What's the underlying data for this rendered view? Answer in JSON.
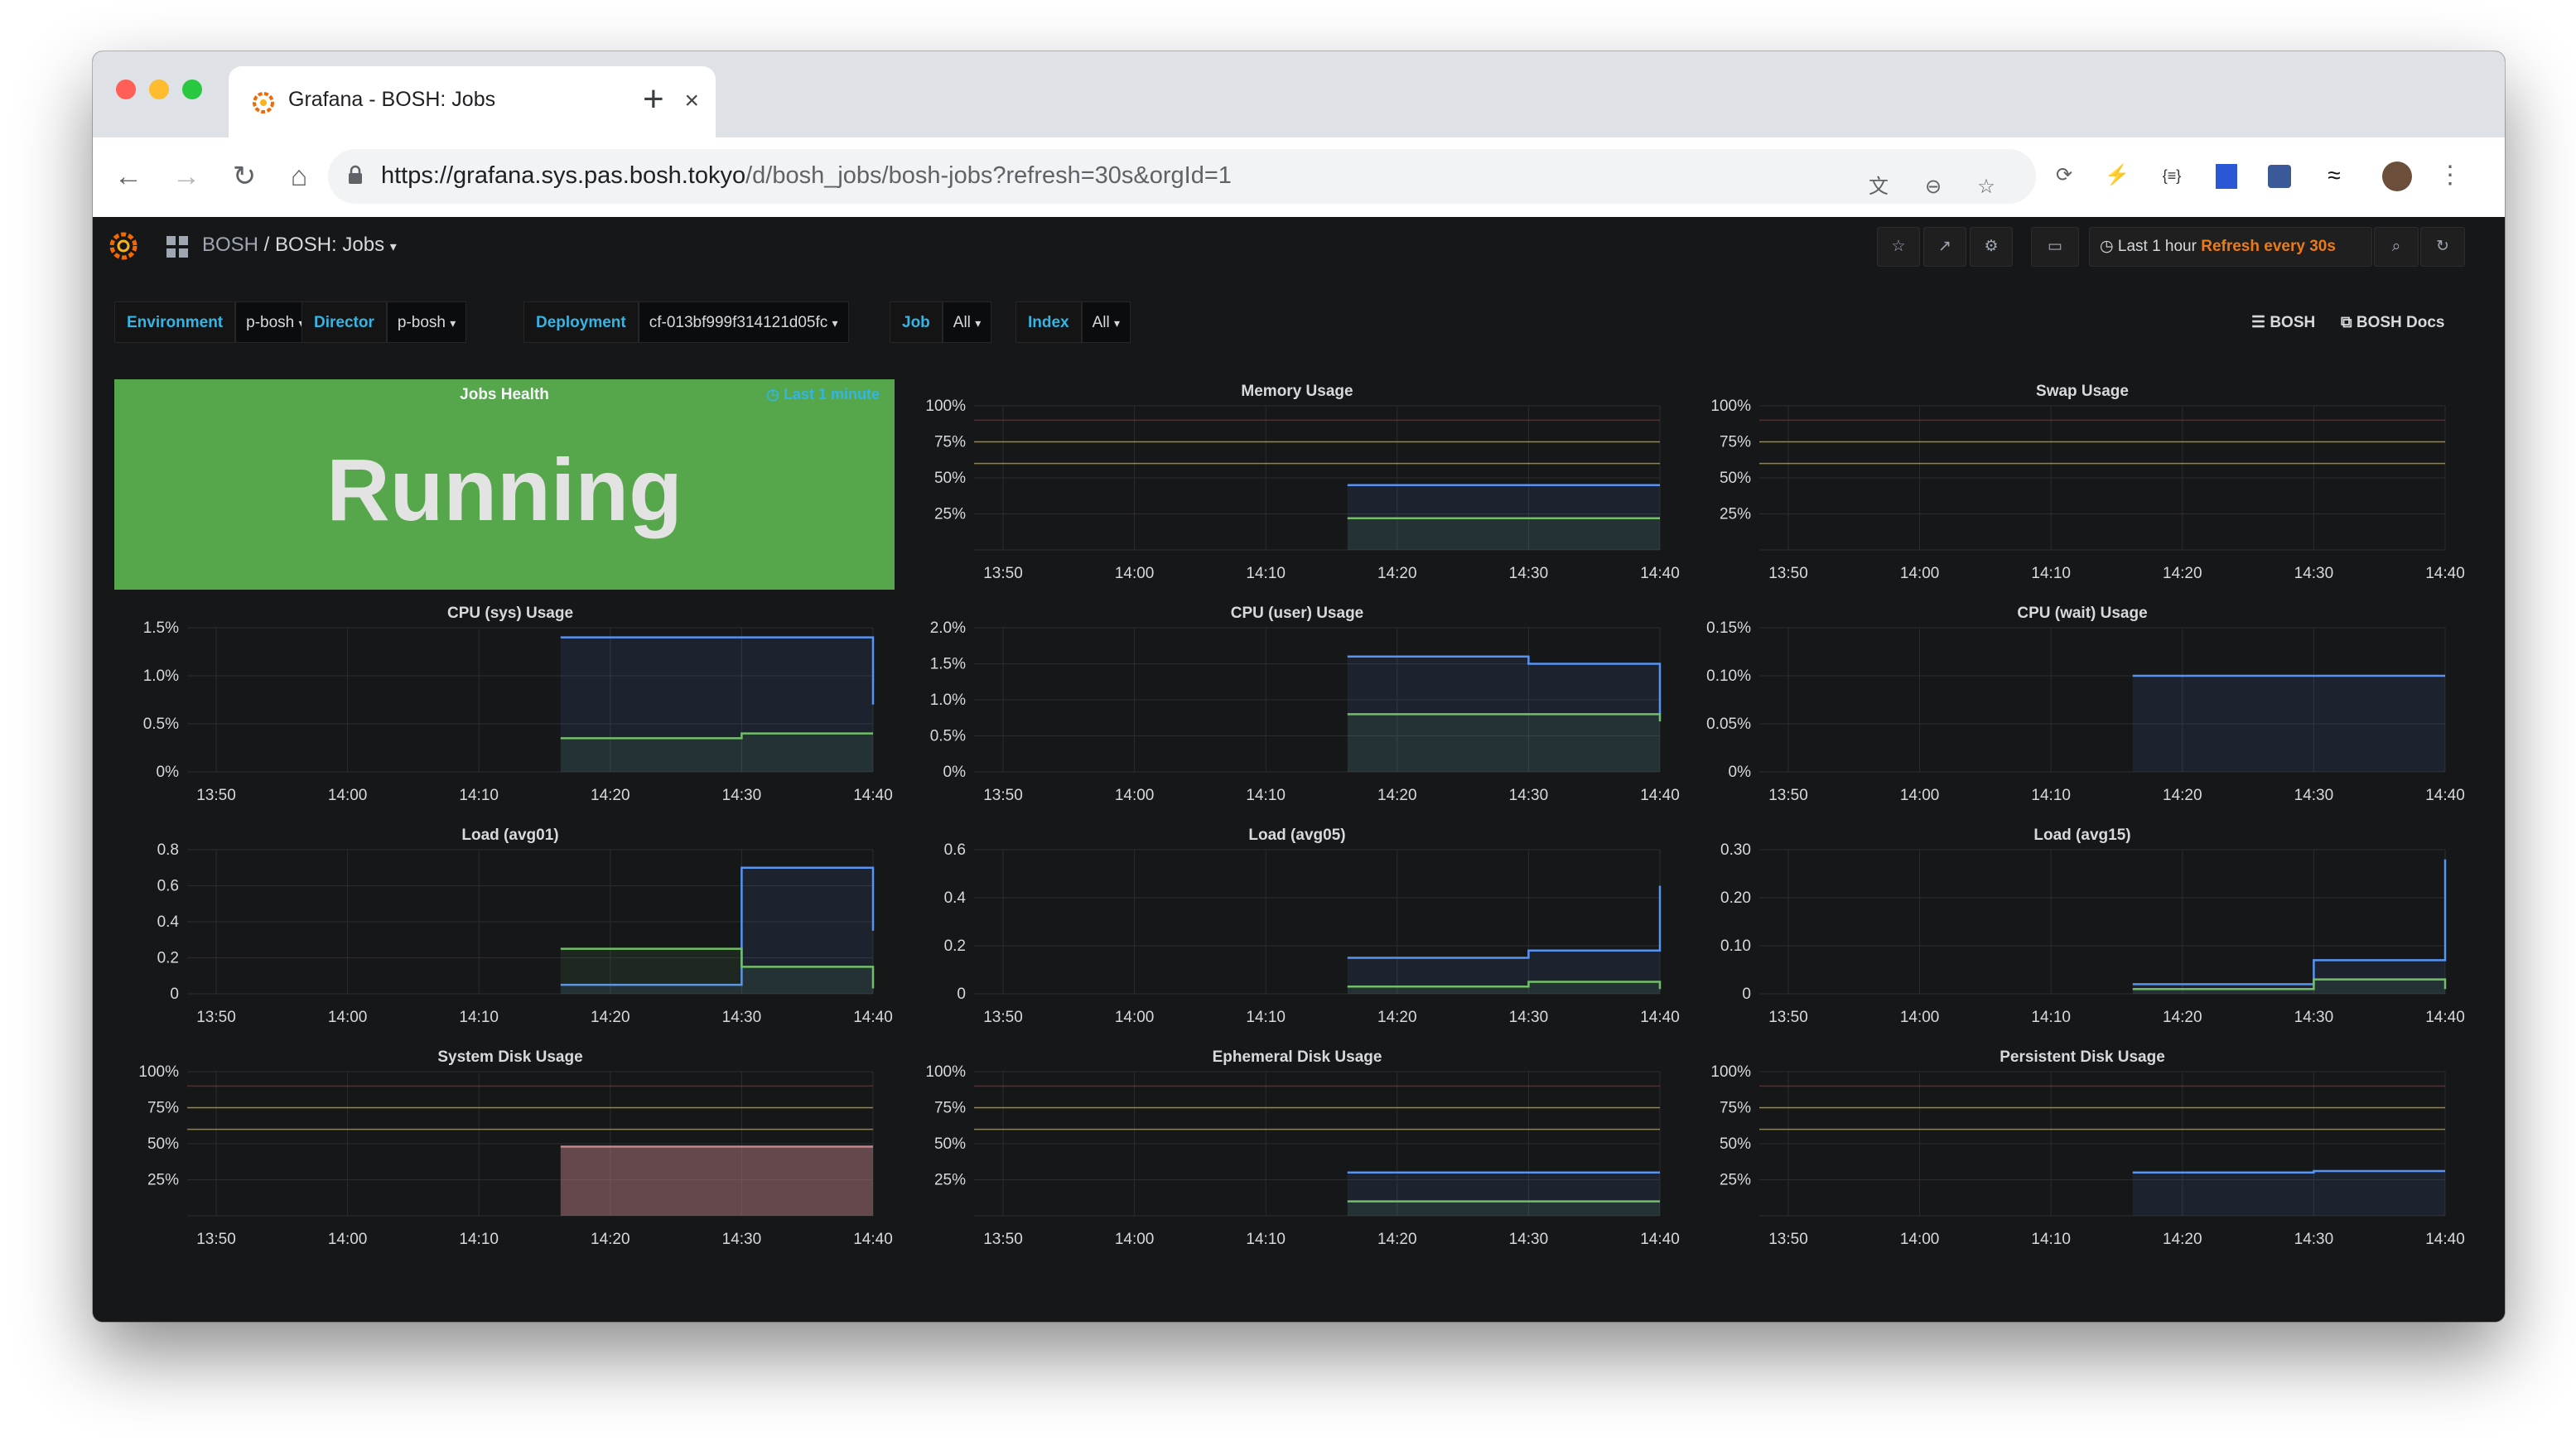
{
  "browser": {
    "tab_title": "Grafana - BOSH: Jobs",
    "url_host": "https://grafana.sys.pas.bosh.tokyo",
    "url_path": "/d/bosh_jobs/bosh-jobs?refresh=30s&orgId=1",
    "new_tab_label": "+",
    "tab_close_label": "×"
  },
  "grafana": {
    "breadcrumb_folder": "BOSH",
    "breadcrumb_sep": " / ",
    "dashboard_title": "BOSH: Jobs",
    "time_range": "Last 1 hour",
    "refresh_label": "Refresh every 30s",
    "variables": [
      {
        "label": "Environment",
        "value": "p-bosh"
      },
      {
        "label": "Director",
        "value": "p-bosh"
      },
      {
        "label": "Deployment",
        "value": "cf-013bf999f314121d05fc"
      },
      {
        "label": "Job",
        "value": "All"
      },
      {
        "label": "Index",
        "value": "All"
      }
    ],
    "links": [
      "BOSH",
      "BOSH Docs"
    ]
  },
  "jobs_health": {
    "title": "Jobs Health",
    "time_override": "Last 1 minute",
    "value": "Running",
    "color": "#56a64b"
  },
  "colors": {
    "blue": "#5794f2",
    "bg": "#161719",
    "grid": "#2c2c2f",
    "threshold_yellow": "#c9b634",
    "threshold_red": "#8a2f2f"
  },
  "panels": [
    {
      "id": "memory",
      "title": "Memory Usage",
      "yticks": [
        "100%",
        "75%",
        "50%",
        "25%"
      ],
      "xticks": [
        "13:50",
        "14:00",
        "14:10",
        "14:20",
        "14:30",
        "14:40"
      ]
    },
    {
      "id": "swap",
      "title": "Swap Usage",
      "yticks": [
        "100%",
        "75%",
        "50%",
        "25%"
      ],
      "xticks": [
        "13:50",
        "14:00",
        "14:10",
        "14:20",
        "14:30",
        "14:40"
      ]
    },
    {
      "id": "cpu-sys",
      "title": "CPU (sys) Usage",
      "yticks": [
        "1.5%",
        "1.0%",
        "0.5%",
        "0%"
      ],
      "xticks": [
        "13:50",
        "14:00",
        "14:10",
        "14:20",
        "14:30",
        "14:40"
      ]
    },
    {
      "id": "cpu-user",
      "title": "CPU (user) Usage",
      "yticks": [
        "2.0%",
        "1.5%",
        "1.0%",
        "0.5%",
        "0%"
      ],
      "xticks": [
        "13:50",
        "14:00",
        "14:10",
        "14:20",
        "14:30",
        "14:40"
      ]
    },
    {
      "id": "cpu-wait",
      "title": "CPU (wait) Usage",
      "yticks": [
        "0.15%",
        "0.10%",
        "0.05%",
        "0%"
      ],
      "xticks": [
        "13:50",
        "14:00",
        "14:10",
        "14:20",
        "14:30",
        "14:40"
      ]
    },
    {
      "id": "load1",
      "title": "Load (avg01)",
      "yticks": [
        "0.8",
        "0.6",
        "0.4",
        "0.2",
        "0"
      ],
      "xticks": [
        "13:50",
        "14:00",
        "14:10",
        "14:20",
        "14:30",
        "14:40"
      ]
    },
    {
      "id": "load5",
      "title": "Load (avg05)",
      "yticks": [
        "0.6",
        "0.4",
        "0.2",
        "0"
      ],
      "xticks": [
        "13:50",
        "14:00",
        "14:10",
        "14:20",
        "14:30",
        "14:40"
      ]
    },
    {
      "id": "load15",
      "title": "Load (avg15)",
      "yticks": [
        "0.30",
        "0.20",
        "0.10",
        "0"
      ],
      "xticks": [
        "13:50",
        "14:00",
        "14:10",
        "14:20",
        "14:30",
        "14:40"
      ]
    },
    {
      "id": "sysdisk",
      "title": "System Disk Usage",
      "yticks": [
        "100%",
        "75%",
        "50%",
        "25%"
      ],
      "xticks": [
        "13:50",
        "14:00",
        "14:10",
        "14:20",
        "14:30",
        "14:40"
      ]
    },
    {
      "id": "ephdisk",
      "title": "Ephemeral Disk Usage",
      "yticks": [
        "100%",
        "75%",
        "50%",
        "25%"
      ],
      "xticks": [
        "13:50",
        "14:00",
        "14:10",
        "14:20",
        "14:30",
        "14:40"
      ]
    },
    {
      "id": "perdisk",
      "title": "Persistent Disk Usage",
      "yticks": [
        "100%",
        "75%",
        "50%",
        "25%"
      ],
      "xticks": [
        "13:50",
        "14:00",
        "14:10",
        "14:20",
        "14:30",
        "14:40"
      ]
    }
  ],
  "chart_data": [
    {
      "type": "line",
      "title": "Memory Usage",
      "x": [
        "13:50",
        "14:00",
        "14:10",
        "14:20",
        "14:30",
        "14:40"
      ],
      "ylim": [
        0,
        100
      ],
      "series": [
        {
          "values": [
            null,
            null,
            null,
            45,
            45,
            45
          ]
        },
        {
          "values": [
            null,
            null,
            null,
            22,
            22,
            22
          ]
        }
      ]
    },
    {
      "type": "line",
      "title": "Swap Usage",
      "x": [
        "13:50",
        "14:00",
        "14:10",
        "14:20",
        "14:30",
        "14:40"
      ],
      "ylim": [
        0,
        100
      ],
      "series": []
    },
    {
      "type": "line",
      "title": "CPU (sys) Usage",
      "x": [
        "13:50",
        "14:00",
        "14:10",
        "14:20",
        "14:30",
        "14:40"
      ],
      "ylim": [
        0,
        1.5
      ],
      "series": [
        {
          "values": [
            null,
            null,
            null,
            1.4,
            1.4,
            0.7
          ]
        },
        {
          "values": [
            null,
            null,
            null,
            0.35,
            0.4,
            0.4
          ]
        }
      ]
    },
    {
      "type": "line",
      "title": "CPU (user) Usage",
      "x": [
        "13:50",
        "14:00",
        "14:10",
        "14:20",
        "14:30",
        "14:40"
      ],
      "ylim": [
        0,
        2.0
      ],
      "series": [
        {
          "values": [
            null,
            null,
            null,
            1.6,
            1.5,
            0.8
          ]
        },
        {
          "values": [
            null,
            null,
            null,
            0.8,
            0.8,
            0.7
          ]
        }
      ]
    },
    {
      "type": "line",
      "title": "CPU (wait) Usage",
      "x": [
        "13:50",
        "14:00",
        "14:10",
        "14:20",
        "14:30",
        "14:40"
      ],
      "ylim": [
        0,
        0.15
      ],
      "series": [
        {
          "values": [
            null,
            null,
            null,
            0.1,
            0.1,
            0.1
          ]
        }
      ]
    },
    {
      "type": "line",
      "title": "Load (avg01)",
      "x": [
        "13:50",
        "14:00",
        "14:10",
        "14:20",
        "14:30",
        "14:40"
      ],
      "ylim": [
        0,
        0.8
      ],
      "series": [
        {
          "values": [
            null,
            null,
            null,
            0.05,
            0.7,
            0.35
          ]
        },
        {
          "values": [
            null,
            null,
            null,
            0.25,
            0.15,
            0.03
          ]
        }
      ]
    },
    {
      "type": "line",
      "title": "Load (avg05)",
      "x": [
        "13:50",
        "14:00",
        "14:10",
        "14:20",
        "14:30",
        "14:40"
      ],
      "ylim": [
        0,
        0.6
      ],
      "series": [
        {
          "values": [
            null,
            null,
            null,
            0.15,
            0.18,
            0.45
          ]
        },
        {
          "values": [
            null,
            null,
            null,
            0.03,
            0.05,
            0.02
          ]
        }
      ]
    },
    {
      "type": "line",
      "title": "Load (avg15)",
      "x": [
        "13:50",
        "14:00",
        "14:10",
        "14:20",
        "14:30",
        "14:40"
      ],
      "ylim": [
        0,
        0.3
      ],
      "series": [
        {
          "values": [
            null,
            null,
            null,
            0.02,
            0.07,
            0.28
          ]
        },
        {
          "values": [
            null,
            null,
            null,
            0.01,
            0.03,
            0.01
          ]
        }
      ]
    },
    {
      "type": "area",
      "title": "System Disk Usage",
      "x": [
        "13:50",
        "14:00",
        "14:10",
        "14:20",
        "14:30",
        "14:40"
      ],
      "ylim": [
        0,
        100
      ],
      "series": [
        {
          "values": [
            null,
            null,
            null,
            48,
            48,
            48
          ]
        }
      ]
    },
    {
      "type": "line",
      "title": "Ephemeral Disk Usage",
      "x": [
        "13:50",
        "14:00",
        "14:10",
        "14:20",
        "14:30",
        "14:40"
      ],
      "ylim": [
        0,
        100
      ],
      "series": [
        {
          "values": [
            null,
            null,
            null,
            30,
            30,
            30
          ]
        },
        {
          "values": [
            null,
            null,
            null,
            10,
            10,
            10
          ]
        }
      ]
    },
    {
      "type": "line",
      "title": "Persistent Disk Usage",
      "x": [
        "13:50",
        "14:00",
        "14:10",
        "14:20",
        "14:30",
        "14:40"
      ],
      "ylim": [
        0,
        100
      ],
      "series": [
        {
          "values": [
            null,
            null,
            null,
            30,
            31,
            31
          ]
        }
      ]
    }
  ]
}
